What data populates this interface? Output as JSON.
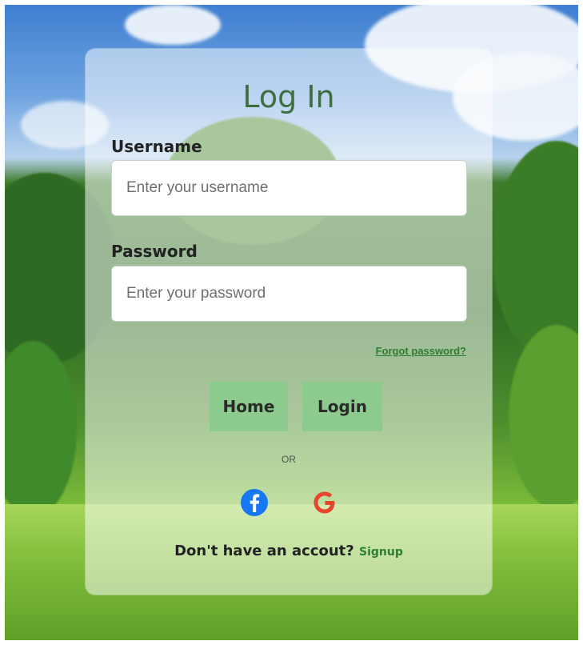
{
  "login": {
    "title": "Log In",
    "username_label": "Username",
    "username_placeholder": "Enter your username",
    "password_label": "Password",
    "password_placeholder": "Enter your password",
    "forgot_password": "Forgot password?",
    "home_button": "Home",
    "login_button": "Login",
    "or_text": "OR",
    "signup_prompt": "Don't have an accout?",
    "signup_link": "Signup"
  },
  "social": [
    "facebook-icon",
    "google-icon"
  ],
  "colors": {
    "title": "#3f6e43",
    "button_bg": "#8cca8e",
    "link": "#2e7d32",
    "facebook": "#1877f2",
    "google": "#e8452f"
  }
}
